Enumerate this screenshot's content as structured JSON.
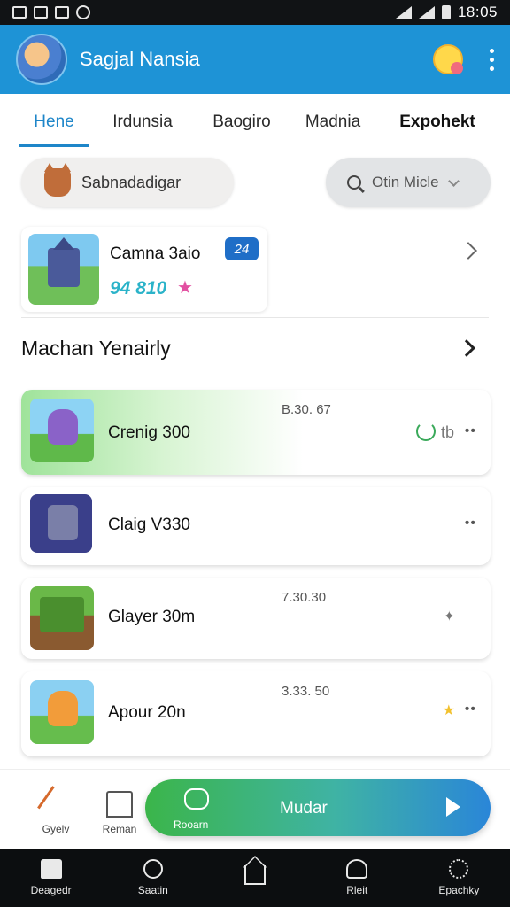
{
  "status_bar": {
    "time": "18:05"
  },
  "app_bar": {
    "title": "Sagjal Nansia"
  },
  "tabs": [
    {
      "label": "Hene",
      "active": true
    },
    {
      "label": "Irdunsia"
    },
    {
      "label": "Baogiro"
    },
    {
      "label": "Madnia"
    },
    {
      "label": "Expohekt"
    }
  ],
  "filters": {
    "left_chip": "Sabnadadigar",
    "right_chip": "Otin Micle"
  },
  "featured": {
    "title": "Camna 3aio",
    "badge": "24",
    "score": "94 810"
  },
  "section": {
    "title": "Machan Yenairly"
  },
  "games": [
    {
      "title": "Crenig 300",
      "meta": "B.30. 67",
      "tag": "tb"
    },
    {
      "title": "Claig V330",
      "meta": ""
    },
    {
      "title": "Glayer 30m",
      "meta": "7.30.30"
    },
    {
      "title": "Apour 20n",
      "meta": "3.33. 50"
    }
  ],
  "actions": {
    "item1": "Gyelv",
    "item2": "Reman",
    "big_button_label": "Mudar",
    "big_button_sub": "Rooarn"
  },
  "bottom_nav": [
    {
      "label": "Deagedr"
    },
    {
      "label": "Saatin"
    },
    {
      "label": ""
    },
    {
      "label": "Rleit"
    },
    {
      "label": "Epachky"
    }
  ],
  "colors": {
    "primary": "#1e93d6",
    "accent_green": "#3bb54a",
    "tab_active": "#1e86c9"
  }
}
